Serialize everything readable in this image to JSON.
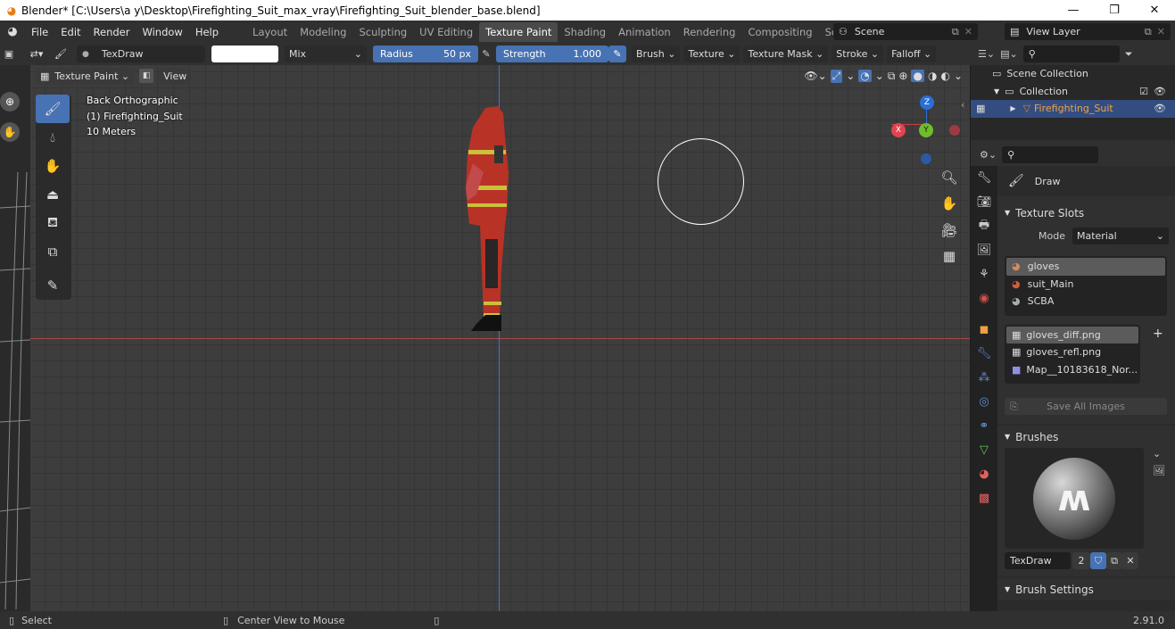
{
  "window": {
    "title": "Blender* [C:\\Users\\a y\\Desktop\\Firefighting_Suit_max_vray\\Firefighting_Suit_blender_base.blend]",
    "minimize": "—",
    "maximize": "❐",
    "close": "✕"
  },
  "menu": [
    "File",
    "Edit",
    "Render",
    "Window",
    "Help"
  ],
  "workspaces": [
    {
      "label": "Layout",
      "active": false
    },
    {
      "label": "Modeling",
      "active": false
    },
    {
      "label": "Sculpting",
      "active": false
    },
    {
      "label": "UV Editing",
      "active": false
    },
    {
      "label": "Texture Paint",
      "active": true
    },
    {
      "label": "Shading",
      "active": false
    },
    {
      "label": "Animation",
      "active": false
    },
    {
      "label": "Rendering",
      "active": false
    },
    {
      "label": "Compositing",
      "active": false
    },
    {
      "label": "Scripting",
      "active": false
    }
  ],
  "scene": {
    "add": "+",
    "name": "Scene",
    "view_layer": "View Layer"
  },
  "tool_header": {
    "brush_name": "TexDraw",
    "color_hex": "#ffffff",
    "blend_mode": "Mix",
    "radius_label": "Radius",
    "radius_value": "50 px",
    "strength_label": "Strength",
    "strength_value": "1.000",
    "menus": [
      "Brush",
      "Texture",
      "Texture Mask",
      "Stroke",
      "Falloff"
    ]
  },
  "viewport_header": {
    "mode": "Texture Paint",
    "view": "View"
  },
  "viewport_overlay": {
    "view_name": "Back Orthographic",
    "object": "(1) Firefighting_Suit",
    "scale": "10 Meters"
  },
  "gizmo": {
    "z": "Z",
    "y": "Y",
    "x": "X"
  },
  "outliner": {
    "scene_collection": "Scene Collection",
    "collection": "Collection",
    "object": "Firefighting_Suit"
  },
  "properties": {
    "tool_name": "Draw",
    "texture_slots_title": "Texture Slots",
    "mode_label": "Mode",
    "mode_value": "Material",
    "materials": [
      {
        "name": "gloves",
        "selected": true
      },
      {
        "name": "suit_Main",
        "selected": false
      },
      {
        "name": "SCBA",
        "selected": false
      }
    ],
    "images": [
      {
        "name": "gloves_diff.png",
        "selected": true
      },
      {
        "name": "gloves_refl.png",
        "selected": false
      },
      {
        "name": "Map__10183618_Nor...",
        "selected": false
      }
    ],
    "save_all": "Save All Images",
    "brushes_title": "Brushes",
    "brush_name": "TexDraw",
    "brush_users": "2",
    "brush_settings_title": "Brush Settings"
  },
  "statusbar": {
    "select": "Select",
    "center_view": "Center View to Mouse",
    "version": "2.91.0"
  },
  "colors": {
    "accent": "#4772b3",
    "axis_x": "#c44141",
    "axis_y": "#3f75c9",
    "brand": "#e87d0d"
  }
}
